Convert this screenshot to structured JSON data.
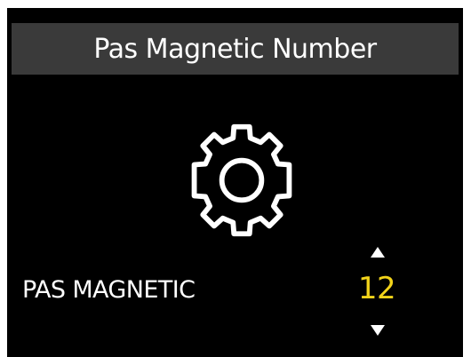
{
  "header": {
    "title": "Pas Magnetic Number"
  },
  "setting": {
    "icon": "gear-icon",
    "label": "PAS MAGNETIC",
    "value": "12"
  },
  "controls": {
    "increase_icon": "arrow-up-icon",
    "decrease_icon": "arrow-down-icon"
  },
  "colors": {
    "background": "#000000",
    "title_bar": "#3a3a3a",
    "text": "#ffffff",
    "value": "#f2d31a"
  }
}
